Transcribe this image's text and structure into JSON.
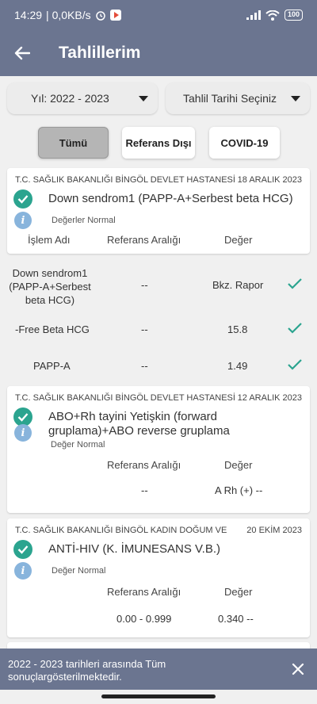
{
  "status": {
    "time": "14:29",
    "net": "| 0,0KB/s",
    "battery": "100"
  },
  "app": {
    "title": "Tahlillerim"
  },
  "filters": {
    "year": "Yıl: 2022 - 2023",
    "date_picker": "Tahlil Tarihi Seçiniz"
  },
  "tabs": {
    "all": "Tümü",
    "out_of_ref": "Referans Dışı",
    "covid": "COVID-19"
  },
  "results": [
    {
      "hospital": "T.C. SAĞLIK BAKANLIĞI BİNGÖL DEVLET HASTANESİ",
      "date": "18 ARALIK 2023",
      "title": "Down sendrom1 (PAPP-A+Serbest beta HCG)",
      "status": "Değerler Normal",
      "col_process": "İşlem Adı",
      "col_ref": "Referans Aralığı",
      "col_value": "Değer",
      "rows": [
        {
          "name": "Down sendrom1 (PAPP-A+Serbest beta HCG)",
          "ref": "--",
          "value": "Bkz. Rapor"
        },
        {
          "name": "-Free Beta HCG",
          "ref": "--",
          "value": "15.8"
        },
        {
          "name": "PAPP-A",
          "ref": "--",
          "value": "1.49"
        }
      ]
    },
    {
      "hospital": "T.C. SAĞLIK BAKANLIĞI BİNGÖL DEVLET HASTANESİ",
      "date": "12 ARALIK 2023",
      "title": "ABO+Rh tayini Yetişkin (forward gruplama)+ABO reverse gruplama",
      "status": "Değer Normal",
      "col_ref": "Referans Aralığı",
      "col_value": "Değer",
      "ref": "--",
      "value": "A Rh (+) --"
    },
    {
      "hospital": "T.C. SAĞLIK BAKANLIĞI BİNGÖL KADIN DOĞUM VE",
      "date": "20 EKİM 2023",
      "title": "ANTİ-HIV (K. İMUNESANS V.B.)",
      "status": "Değer Normal",
      "col_ref": "Referans Aralığı",
      "col_value": "Değer",
      "ref": "0.00 - 0.999",
      "value": "0.340 --"
    }
  ],
  "snackbar": {
    "message": "2022 - 2023 tarihleri arasında Tüm sonuçlargösterilmektedir."
  },
  "colors": {
    "primary": "#6b7590",
    "ok_green": "#2ba48f",
    "info_blue": "#88b4dc"
  },
  "icons": {
    "back": "arrow-left-icon",
    "ok": "check-circle-icon",
    "info": "info-icon",
    "close": "close-icon"
  }
}
